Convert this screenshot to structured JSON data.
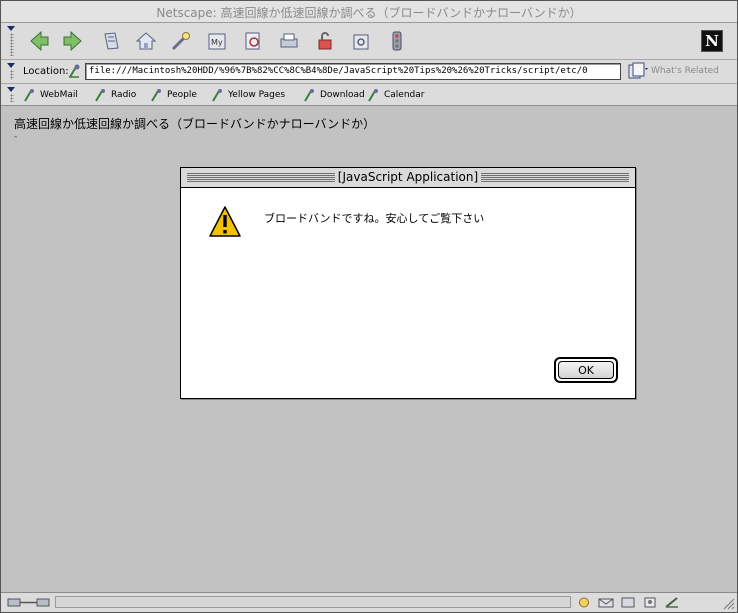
{
  "window": {
    "title": "Netscape: 高速回線か低速回線か調べる（ブロードバンドかナローバンドか）"
  },
  "toolbar": {
    "buttons": [
      {
        "name": "back-icon"
      },
      {
        "name": "forward-icon"
      },
      {
        "name": "reload-icon"
      },
      {
        "name": "home-icon"
      },
      {
        "name": "search-icon"
      },
      {
        "name": "my-netscape-icon"
      },
      {
        "name": "images-icon"
      },
      {
        "name": "print-icon"
      },
      {
        "name": "security-icon"
      },
      {
        "name": "shop-icon"
      },
      {
        "name": "stop-icon"
      }
    ],
    "logo_letter": "N"
  },
  "location": {
    "label": "Location:",
    "url": "file:///Macintosh%20HDD/%96%7B%82%CC%8C%B4%8De/JavaScript%20Tips%20%26%20Tricks/script/etc/0",
    "related_label": "What's Related"
  },
  "personal_toolbar": {
    "items": [
      {
        "label": "WebMail"
      },
      {
        "label": "Radio"
      },
      {
        "label": "People"
      },
      {
        "label": "Yellow Pages"
      },
      {
        "label": "Download"
      },
      {
        "label": "Calendar"
      }
    ]
  },
  "page": {
    "heading": "高速回線か低速回線か調べる（ブロードバンドかナローバンドか）",
    "dot": "-"
  },
  "dialog": {
    "title": "[JavaScript Application]",
    "message": "ブロードバンドですね。安心してご覧下さい",
    "ok_label": "OK"
  },
  "colors": {
    "link_icon": "#3c7d3c",
    "warning_yellow": "#f2c200",
    "accent_navy": "#1e2a6a"
  }
}
